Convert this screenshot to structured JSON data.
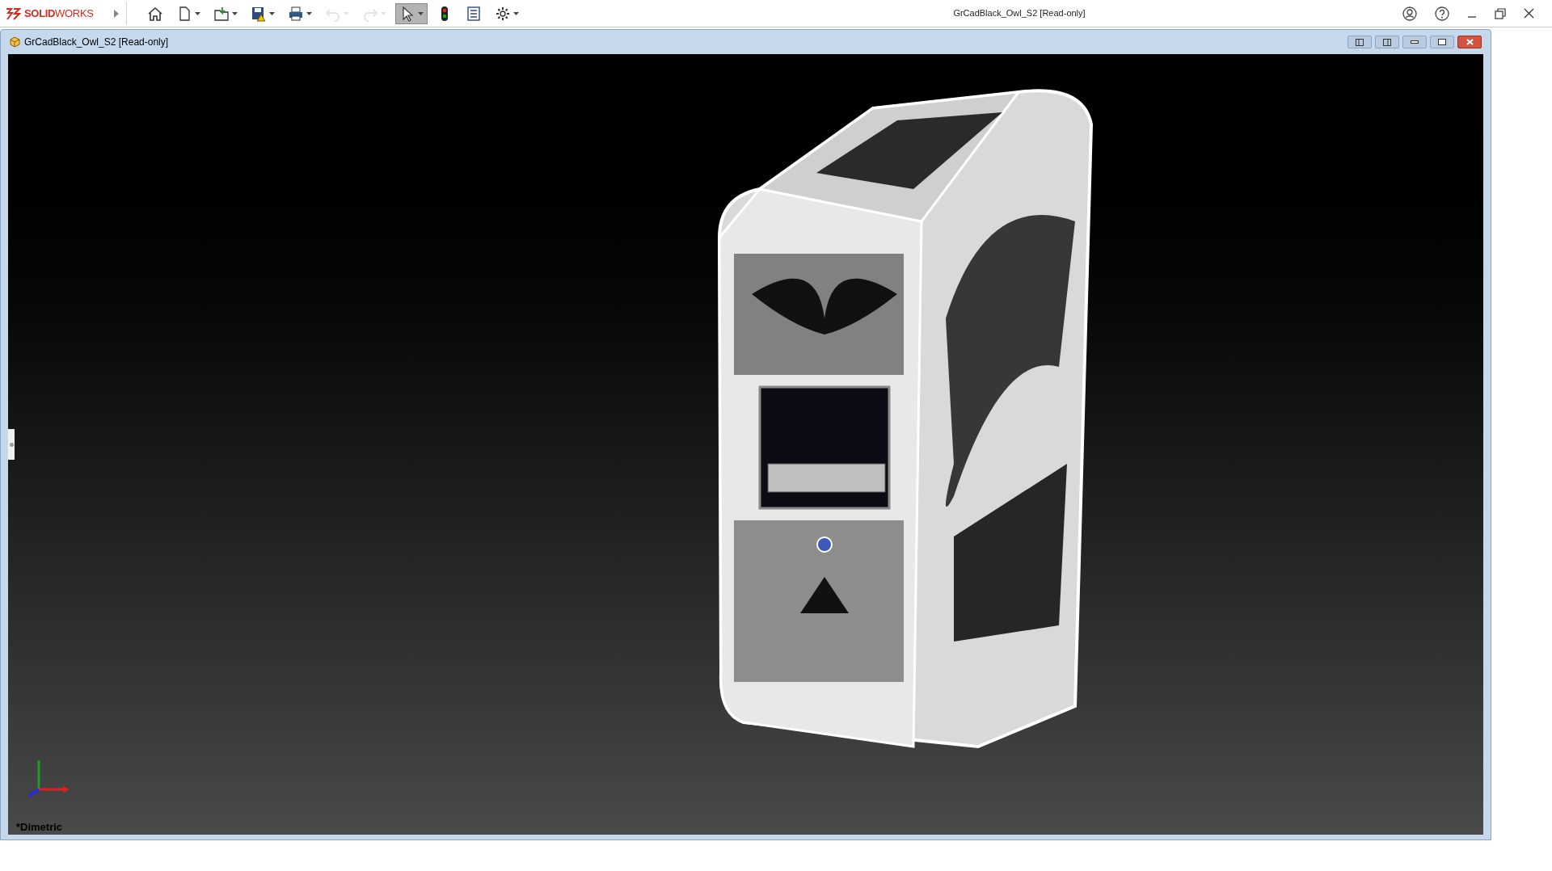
{
  "app": {
    "logo_text": "**SOLID**WORKS",
    "title": "GrCadBlack_Owl_S2 [Read-only]"
  },
  "toolbar": [
    {
      "kind": "home",
      "dropdown": false,
      "disabled": false,
      "selected": false
    },
    {
      "kind": "new",
      "dropdown": true,
      "disabled": false,
      "selected": false
    },
    {
      "kind": "open",
      "dropdown": true,
      "disabled": false,
      "selected": false
    },
    {
      "kind": "save",
      "dropdown": true,
      "disabled": false,
      "selected": false
    },
    {
      "kind": "print",
      "dropdown": true,
      "disabled": false,
      "selected": false
    },
    {
      "kind": "undo",
      "dropdown": true,
      "disabled": true,
      "selected": false
    },
    {
      "kind": "redo",
      "dropdown": true,
      "disabled": true,
      "selected": false
    },
    {
      "kind": "select",
      "dropdown": true,
      "disabled": false,
      "selected": true
    },
    {
      "kind": "rebuild",
      "dropdown": false,
      "disabled": false,
      "selected": false
    },
    {
      "kind": "properties",
      "dropdown": false,
      "disabled": false,
      "selected": false
    },
    {
      "kind": "options",
      "dropdown": true,
      "disabled": false,
      "selected": false
    }
  ],
  "document": {
    "title": "GrCadBlack_Owl_S2 [Read-only]",
    "view_label": "*Dimetric"
  }
}
